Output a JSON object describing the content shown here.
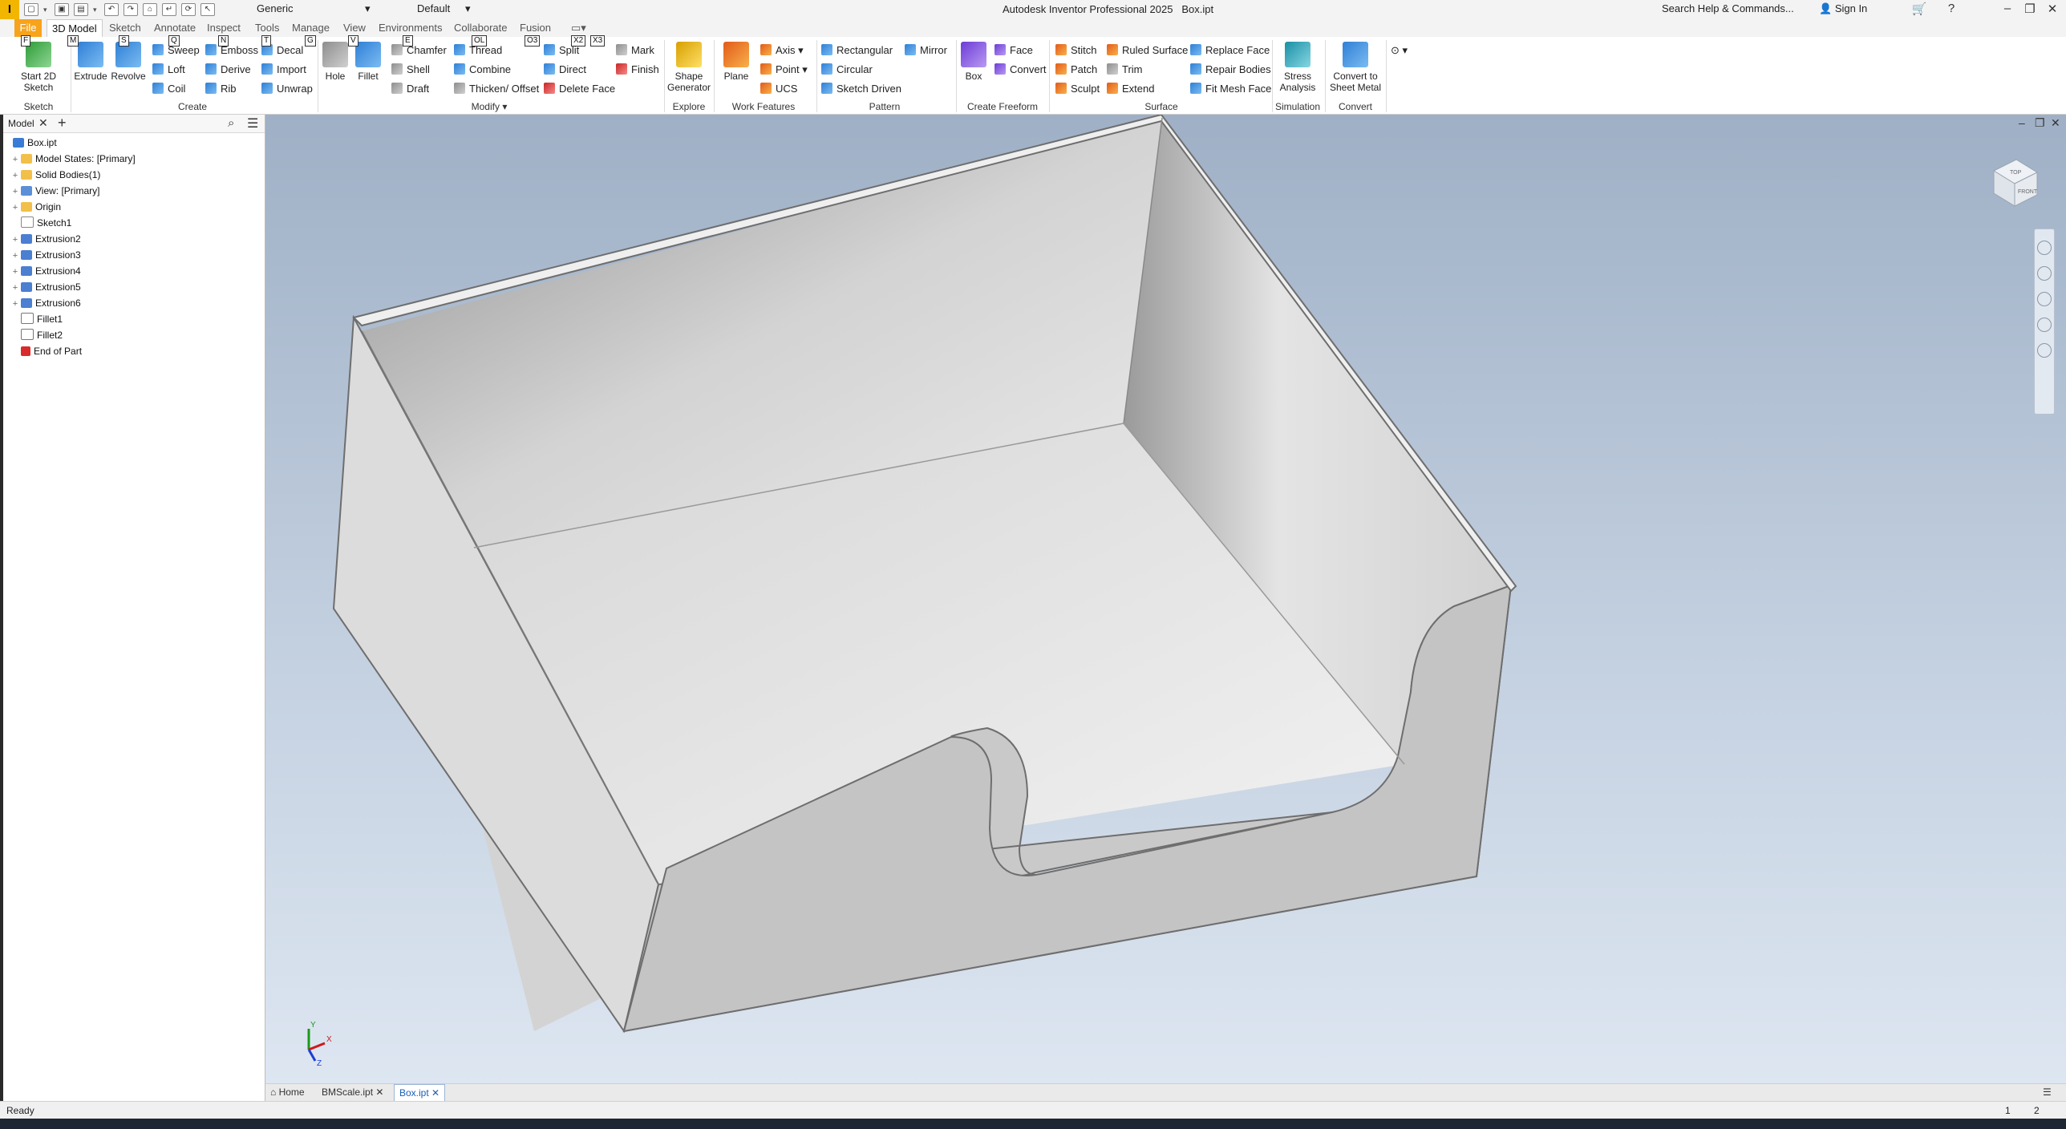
{
  "titlebar": {
    "logo": "I",
    "appearance": "Generic",
    "material": "Default",
    "title": "Autodesk Inventor Professional 2025",
    "filename": "Box.ipt",
    "search_placeholder": "Search Help & Commands...",
    "sign_in": "Sign In"
  },
  "menu": {
    "file": "File",
    "tabs": [
      "3D Model",
      "Sketch",
      "Annotate",
      "Inspect",
      "Tools",
      "Manage",
      "View",
      "Environments",
      "Collaborate",
      "Fusion"
    ]
  },
  "ribbon": {
    "sketch": {
      "label": "Sketch",
      "start": "Start 2D Sketch"
    },
    "create": {
      "label": "Create",
      "extrude": "Extrude",
      "revolve": "Revolve",
      "sweep": "Sweep",
      "loft": "Loft",
      "coil": "Coil",
      "emboss": "Emboss",
      "derive": "Derive",
      "rib": "Rib",
      "decal": "Decal",
      "import": "Import",
      "unwrap": "Unwrap"
    },
    "modify": {
      "label": "Modify",
      "hole": "Hole",
      "fillet": "Fillet",
      "chamfer": "Chamfer",
      "shell": "Shell",
      "draft": "Draft",
      "thread": "Thread",
      "combine": "Combine",
      "thicken": "Thicken/ Offset",
      "split": "Split",
      "direct": "Direct",
      "delete_face": "Delete Face",
      "mark": "Mark",
      "finish": "Finish"
    },
    "explore": {
      "label": "Explore",
      "shape_generator": "Shape Generator"
    },
    "work_features": {
      "label": "Work Features",
      "plane": "Plane",
      "axis": "Axis",
      "point": "Point",
      "ucs": "UCS"
    },
    "pattern": {
      "label": "Pattern",
      "rectangular": "Rectangular",
      "circular": "Circular",
      "sketch_driven": "Sketch Driven",
      "mirror": "Mirror"
    },
    "freeform": {
      "label": "Create Freeform",
      "box": "Box",
      "face": "Face",
      "convert": "Convert"
    },
    "surface": {
      "label": "Surface",
      "stitch": "Stitch",
      "patch": "Patch",
      "sculpt": "Sculpt",
      "ruled_surface": "Ruled Surface",
      "trim": "Trim",
      "extend": "Extend",
      "replace_face": "Replace Face",
      "repair_bodies": "Repair Bodies",
      "fit_mesh_face": "Fit Mesh Face"
    },
    "simulation": {
      "label": "Simulation",
      "stress": "Stress Analysis"
    },
    "convert": {
      "label": "Convert",
      "sheet_metal": "Convert to Sheet Metal"
    }
  },
  "keytips": [
    "F",
    "M",
    "S",
    "Q",
    "N",
    "G",
    "T",
    "V",
    "E",
    "OL",
    "O3",
    "X2",
    "X3"
  ],
  "browser": {
    "tab": "Model",
    "items": [
      {
        "label": "Box.ipt",
        "icon": "part-icon",
        "toggle": ""
      },
      {
        "label": "Model States: [Primary]",
        "icon": "folder-icon",
        "toggle": "+"
      },
      {
        "label": "Solid Bodies(1)",
        "icon": "folder-icon",
        "toggle": "+"
      },
      {
        "label": "View: [Primary]",
        "icon": "view-icon",
        "toggle": "+"
      },
      {
        "label": "Origin",
        "icon": "folder-icon",
        "toggle": "+"
      },
      {
        "label": "Sketch1",
        "icon": "sketch-icon",
        "toggle": ""
      },
      {
        "label": "Extrusion2",
        "icon": "extrusion-icon",
        "toggle": "+"
      },
      {
        "label": "Extrusion3",
        "icon": "extrusion-icon",
        "toggle": "+"
      },
      {
        "label": "Extrusion4",
        "icon": "extrusion-icon",
        "toggle": "+"
      },
      {
        "label": "Extrusion5",
        "icon": "extrusion-icon",
        "toggle": "+"
      },
      {
        "label": "Extrusion6",
        "icon": "extrusion-icon",
        "toggle": "+"
      },
      {
        "label": "Fillet1",
        "icon": "fillet-icon",
        "toggle": ""
      },
      {
        "label": "Fillet2",
        "icon": "fillet-icon",
        "toggle": ""
      },
      {
        "label": "End of Part",
        "icon": "end-of-part-icon",
        "toggle": ""
      }
    ]
  },
  "viewcube": {
    "top": "TOP",
    "front": "FRONT"
  },
  "triad": {
    "x": "X",
    "y": "Y",
    "z": "Z"
  },
  "doc_tabs": [
    "Home",
    "BMScale.ipt",
    "Box.ipt"
  ],
  "status": {
    "text": "Ready",
    "count1": "1",
    "count2": "2"
  },
  "colors": {
    "file_tab": "#f7a31b",
    "accent": "#1b5fb5",
    "viewport_top": "#9fb0c6",
    "viewport_bottom": "#dde6f1"
  }
}
